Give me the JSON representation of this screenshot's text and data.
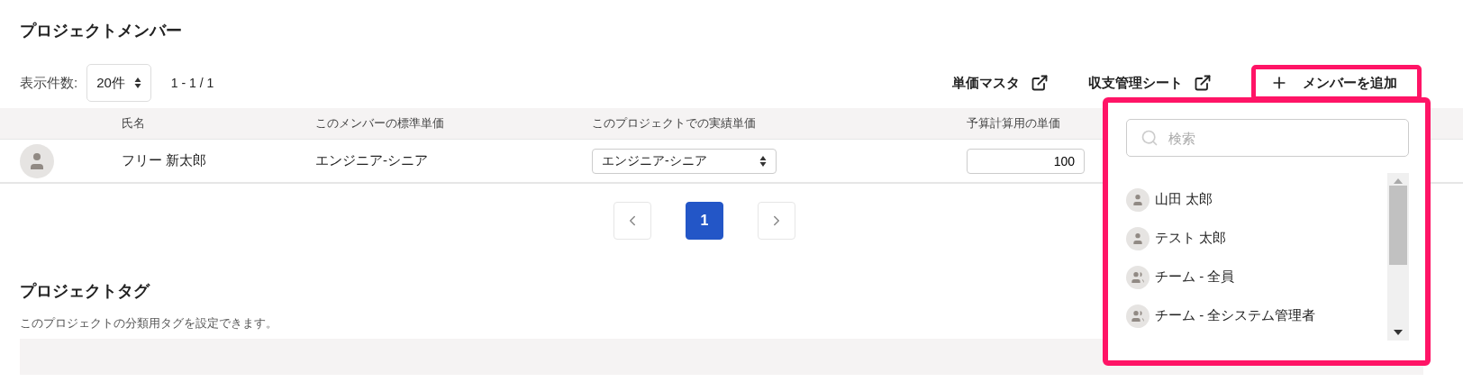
{
  "members": {
    "title": "プロジェクトメンバー",
    "page_size": {
      "label": "表示件数:",
      "value": "20件"
    },
    "range": "1 - 1 / 1",
    "links": [
      {
        "label": "単価マスタ"
      },
      {
        "label": "収支管理シート"
      }
    ],
    "add_button": {
      "label": "メンバーを追加"
    },
    "table": {
      "columns": [
        {
          "label": "氏名"
        },
        {
          "label": "このメンバーの標準単価"
        },
        {
          "label": "このプロジェクトでの実績単価"
        },
        {
          "label": "予算計算用の単価"
        }
      ],
      "rows": [
        {
          "name": "フリー 新太郎",
          "standard_rate": "エンジニア-シニア",
          "actual_rate": "エンジニア-シニア",
          "budget_rate": "100"
        }
      ]
    },
    "pagination": [
      {
        "label": "1",
        "selected": true
      }
    ]
  },
  "dropdown": {
    "search": {
      "placeholder": "検索"
    },
    "items": [
      {
        "label": "山田 太郎",
        "kind": "user"
      },
      {
        "label": "テスト 太郎",
        "kind": "user"
      },
      {
        "label": "チーム - 全員",
        "kind": "team"
      },
      {
        "label": "チーム - 全システム管理者",
        "kind": "team"
      }
    ]
  },
  "tags": {
    "title": "プロジェクトタグ",
    "description": "このプロジェクトの分類用タグを設定できます。"
  }
}
